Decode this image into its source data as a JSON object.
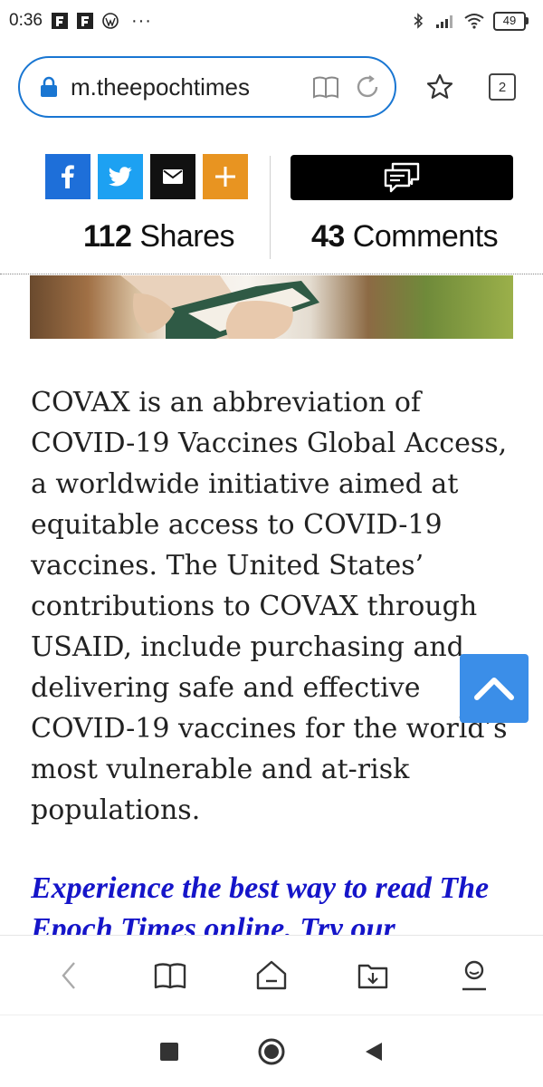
{
  "status_bar": {
    "time": "0:36",
    "battery": "49",
    "icons": [
      "flipboard-icon",
      "flipboard-icon",
      "wordpress-icon",
      "more-dots-icon",
      "bluetooth-icon",
      "signal-icon",
      "wifi-icon",
      "battery-icon"
    ],
    "dots": "···"
  },
  "browser": {
    "url": "m.theepochtimes",
    "tab_count": "2",
    "icons": [
      "lock-icon",
      "reader-mode-icon",
      "reload-icon",
      "star-icon",
      "tabs-icon"
    ]
  },
  "share": {
    "buttons": [
      "facebook-icon",
      "twitter-icon",
      "email-icon",
      "plus-icon"
    ],
    "share_count": "112",
    "share_label": "Shares",
    "comment_count": "43",
    "comment_label": "Comments"
  },
  "article": {
    "paragraph": "COVAX is an abbreviation of COVID-19 Vaccines Global Access, a worldwide initiative aimed at equitable access to COVID-19 vaccines. The United States’ contributions to COVAX through USAID, include purchasing and delivering safe and effective COVID-19 vaccines for the world’s most vulnerable and at-risk populations.",
    "promo": "Experience the best way to read The Epoch Times online. Try our"
  },
  "bottom_nav": [
    "back-icon",
    "bookmarks-icon",
    "home-icon",
    "downloads-icon",
    "profile-icon"
  ],
  "system_nav": [
    "recents-icon",
    "home-circle-icon",
    "back-triangle-icon"
  ],
  "colors": {
    "url_border": "#1976d2",
    "facebook": "#1e6fd9",
    "twitter": "#1da1f2",
    "email": "#111111",
    "more": "#e89421",
    "promo_link": "#1515c9",
    "scroll_top": "#3b8ee8"
  }
}
